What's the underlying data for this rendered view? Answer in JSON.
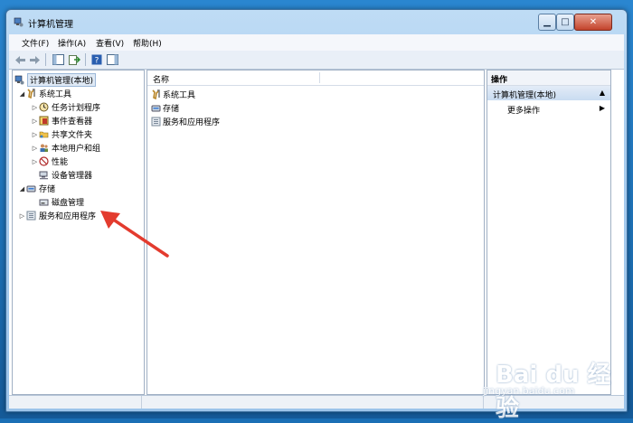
{
  "window": {
    "title": "计算机管理"
  },
  "menubar": {
    "items": [
      "文件(F)",
      "操作(A)",
      "查看(V)",
      "帮助(H)"
    ]
  },
  "tree": {
    "root": "计算机管理(本地)",
    "items": [
      {
        "label": "系统工具",
        "expanded": true,
        "icon": "tools-icon"
      },
      {
        "label": "任务计划程序",
        "icon": "clock-icon"
      },
      {
        "label": "事件查看器",
        "icon": "event-viewer-icon"
      },
      {
        "label": "共享文件夹",
        "icon": "shared-folder-icon"
      },
      {
        "label": "本地用户和组",
        "icon": "users-icon"
      },
      {
        "label": "性能",
        "icon": "performance-icon"
      },
      {
        "label": "设备管理器",
        "icon": "device-manager-icon"
      },
      {
        "label": "存储",
        "expanded": true,
        "icon": "storage-icon"
      },
      {
        "label": "磁盘管理",
        "icon": "disk-icon"
      },
      {
        "label": "服务和应用程序",
        "icon": "services-icon"
      }
    ]
  },
  "list": {
    "column_header": "名称",
    "rows": [
      "系统工具",
      "存储",
      "服务和应用程序"
    ]
  },
  "actions": {
    "header": "操作",
    "section": "计算机管理(本地)",
    "item": "更多操作"
  },
  "watermark": {
    "logo": "Bai du 经验",
    "url": "jingyan.baidu.com"
  },
  "colors": {
    "accent": "#e33b2e",
    "selection": "#dfe9f5",
    "title_bar": "#bfdcf5"
  }
}
